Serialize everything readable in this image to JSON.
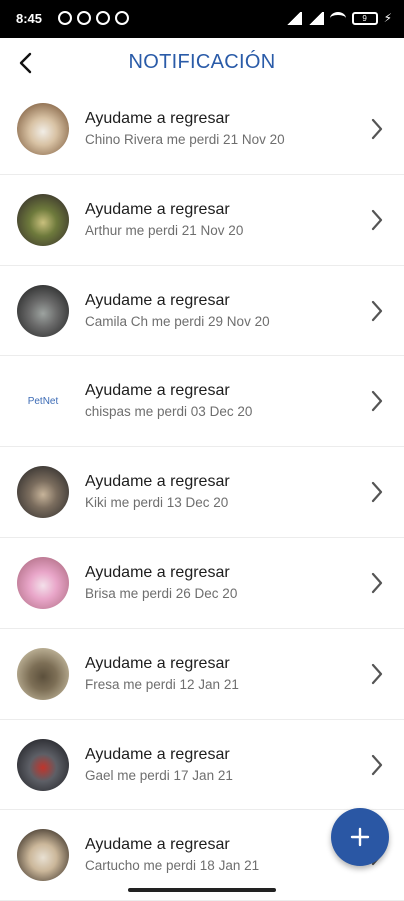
{
  "status_bar": {
    "time": "8:45",
    "battery": "9"
  },
  "header": {
    "title": "NOTIFICACIÓN"
  },
  "notifications": [
    {
      "title": "Ayudame a regresar",
      "subtitle": "Chino Rivera me perdi 21 Nov 20",
      "avatar": "dog-photo"
    },
    {
      "title": "Ayudame a regresar",
      "subtitle": "Arthur me perdi 21 Nov 20",
      "avatar": "dog-photo"
    },
    {
      "title": "Ayudame a regresar",
      "subtitle": "Camila Ch me perdi 29 Nov 20",
      "avatar": "cat-photo"
    },
    {
      "title": "Ayudame a regresar",
      "subtitle": "chispas me perdi 03 Dec 20",
      "avatar": "petnet-logo",
      "logo_text": "PetNet"
    },
    {
      "title": "Ayudame a regresar",
      "subtitle": "Kiki me perdi 13 Dec 20",
      "avatar": "dog-photo"
    },
    {
      "title": "Ayudame a regresar",
      "subtitle": "Brisa me perdi 26 Dec 20",
      "avatar": "dog-photo"
    },
    {
      "title": "Ayudame a regresar",
      "subtitle": "Fresa me perdi 12 Jan 21",
      "avatar": "dog-photo"
    },
    {
      "title": "Ayudame a regresar",
      "subtitle": "Gael me perdi 17 Jan 21",
      "avatar": "cat-photo"
    },
    {
      "title": "Ayudame a regresar",
      "subtitle": "Cartucho me perdi 18 Jan 21",
      "avatar": "dog-photo"
    }
  ],
  "fab": {
    "icon": "plus-icon"
  },
  "colors": {
    "accent": "#2a57a4",
    "title": "#2a5ba8"
  }
}
